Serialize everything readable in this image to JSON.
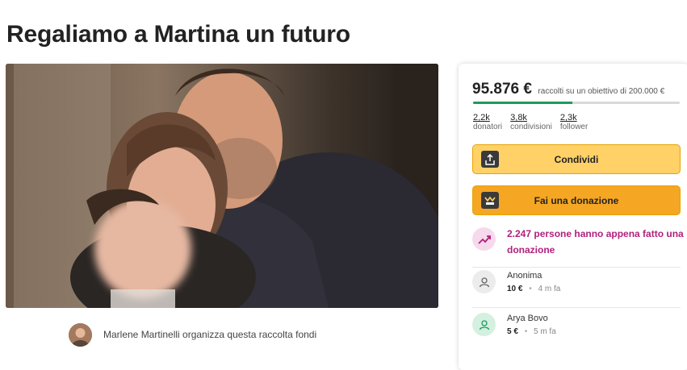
{
  "page": {
    "title": "Regaliamo a Martina un futuro"
  },
  "organizer": {
    "text": "Marlene Martinelli organizza questa raccolta fondi"
  },
  "summary": {
    "raised": "95.876 €",
    "goal_text": "raccolti su un obiettivo di 200.000 €",
    "progress_fraction": 0.479,
    "stats": [
      {
        "value": "2,2k",
        "label": "donatori"
      },
      {
        "value": "3,8k",
        "label": "condivisioni"
      },
      {
        "value": "2,3k",
        "label": "follower"
      }
    ]
  },
  "buttons": {
    "share": "Condividi",
    "donate": "Fai una donazione"
  },
  "trend": {
    "text": "2.247 persone hanno appena fatto una donazione"
  },
  "donations": [
    {
      "name": "Anonima",
      "amount": "10 €",
      "time": "4 m fa",
      "icon": "donor-icon",
      "icon_bg": "#ececec",
      "icon_color": "#666666"
    },
    {
      "name": "Arya Bovo",
      "amount": "5 €",
      "time": "5 m fa",
      "icon": "donor-icon",
      "icon_bg": "#d4f0e0",
      "icon_color": "#1d9a5e"
    }
  ],
  "colors": {
    "accent_green": "#1d9a5e",
    "trend_magenta": "#b0217c",
    "share_yellow": "#ffd166",
    "donate_orange": "#f5a623"
  }
}
